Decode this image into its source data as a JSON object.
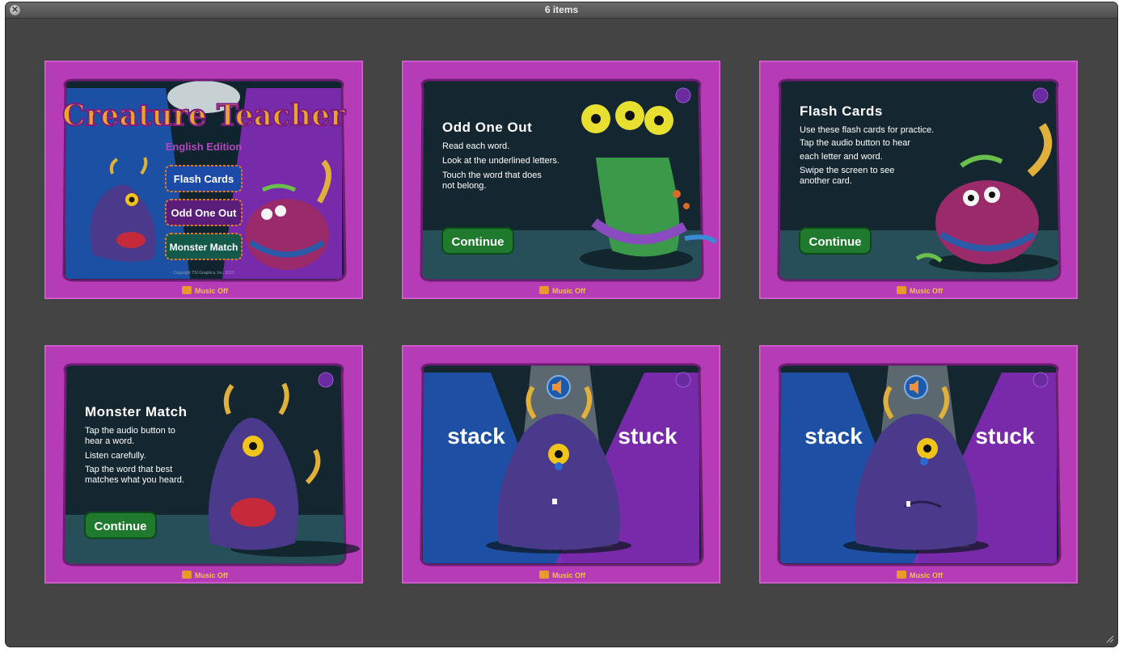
{
  "window": {
    "title": "6 items"
  },
  "slides": [
    {
      "title": "Creature Teacher",
      "subtitle": "English Edition",
      "menu": [
        "Flash Cards",
        "Odd One Out",
        "Monster Match"
      ],
      "copyright": "Copyright TSI Graphics, Inc. 2012",
      "music": "Music Off"
    },
    {
      "heading": "Odd One Out",
      "lines": [
        "Read each word.",
        "Look at the underlined letters.",
        "Touch the word that does",
        "not belong."
      ],
      "button": "Continue",
      "music": "Music Off"
    },
    {
      "heading": "Flash Cards",
      "lines": [
        "Use these flash cards for practice.",
        "Tap the audio button to hear",
        "each letter and word.",
        "Swipe the screen to see",
        "another card."
      ],
      "button": "Continue",
      "music": "Music Off"
    },
    {
      "heading": "Monster Match",
      "lines": [
        "Tap the audio button to",
        "hear a word.",
        "Listen carefully.",
        "Tap the word that best",
        "matches what you heard."
      ],
      "button": "Continue",
      "music": "Music Off"
    },
    {
      "word_left": "stack",
      "word_right": "stuck",
      "music": "Music Off"
    },
    {
      "word_left": "stack",
      "word_right": "stuck",
      "music": "Music Off"
    }
  ]
}
